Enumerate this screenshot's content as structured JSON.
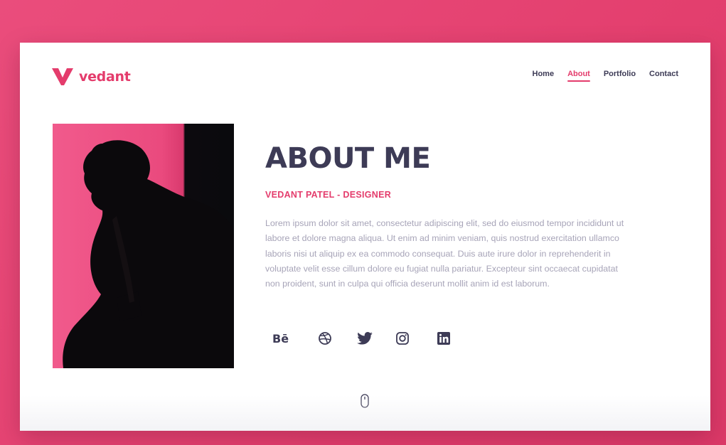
{
  "brand": {
    "name": "vedant",
    "accent_color": "#e43c6c",
    "dark_color": "#3d3b56",
    "background_color": "#e8457a"
  },
  "nav": {
    "items": [
      {
        "label": "Home",
        "active": false
      },
      {
        "label": "About",
        "active": true
      },
      {
        "label": "Portfolio",
        "active": false
      },
      {
        "label": "Contact",
        "active": false
      }
    ]
  },
  "about": {
    "title": "ABOUT ME",
    "subtitle": "VEDANT PATEL - DESIGNER",
    "paragraph": "Lorem ipsum dolor sit amet, consectetur adipiscing elit, sed do eiusmod tempor incididunt ut labore et dolore magna aliqua. Ut enim ad minim veniam, quis nostrud exercitation ullamco laboris nisi ut aliquip ex ea commodo consequat. Duis aute irure dolor in reprehenderit in voluptate velit esse cillum dolore eu fugiat nulla pariatur. Excepteur sint occaecat cupidatat non proident, sunt in culpa qui officia deserunt mollit anim id est laborum."
  },
  "social": {
    "behance_label": "Bē",
    "icons": [
      "behance-icon",
      "dribbble-icon",
      "twitter-icon",
      "instagram-icon",
      "linkedin-icon"
    ]
  },
  "scroll_indicator": {
    "icon": "mouse-scroll-icon"
  }
}
